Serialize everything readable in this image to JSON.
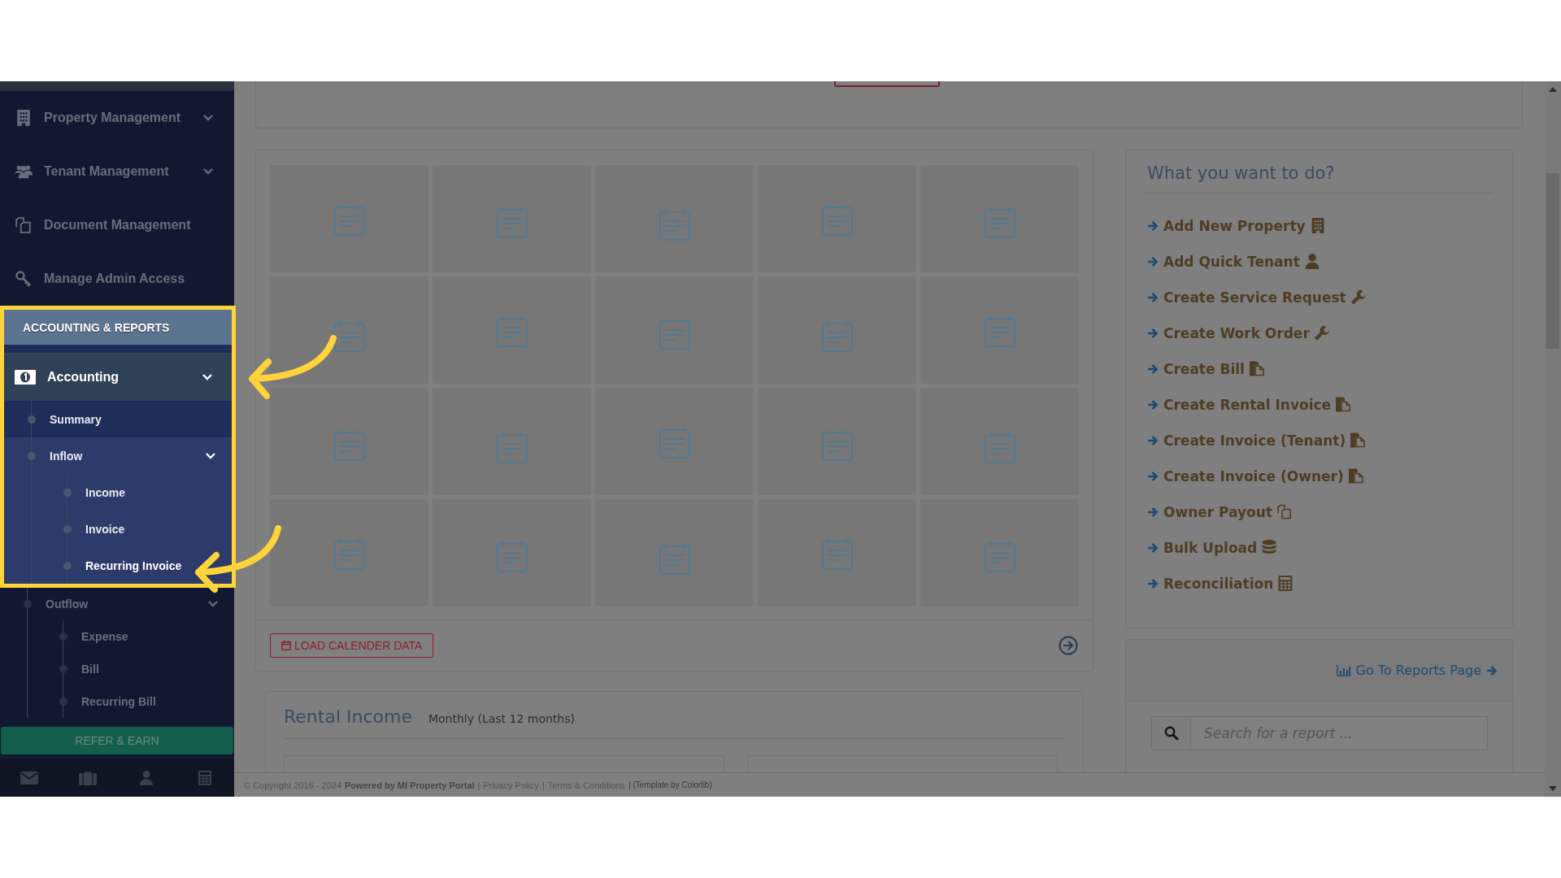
{
  "sidebar": {
    "menu": [
      {
        "label": "Property Management",
        "kind": "building",
        "has_submenu": true
      },
      {
        "label": "Tenant Management",
        "kind": "users",
        "has_submenu": true
      },
      {
        "label": "Document Management",
        "kind": "copy",
        "has_submenu": false
      },
      {
        "label": "Manage Admin Access",
        "kind": "key",
        "has_submenu": false
      }
    ],
    "section": {
      "title": "ACCOUNTING & REPORTS",
      "highlighted": true
    },
    "accounting": {
      "label": "Accounting",
      "kind": "money",
      "has_submenu": true,
      "highlighted": true,
      "children": [
        {
          "label": "Summary",
          "highlighted": true,
          "selected": false
        },
        {
          "label": "Inflow",
          "highlighted": true,
          "selected": false,
          "children": [
            {
              "label": "Income",
              "highlighted": true,
              "selected": false
            },
            {
              "label": "Invoice",
              "highlighted": true,
              "selected": false
            },
            {
              "label": "Recurring Invoice",
              "highlighted": true,
              "selected": true
            }
          ]
        },
        {
          "label": "Outflow",
          "highlighted": false,
          "selected": false,
          "children": [
            {
              "label": "Expense",
              "highlighted": false,
              "selected": false
            },
            {
              "label": "Bill",
              "highlighted": false,
              "selected": false
            },
            {
              "label": "Recurring Bill",
              "highlighted": false,
              "selected": false
            }
          ]
        }
      ]
    },
    "refer_button": "REFER & EARN"
  },
  "calendar": {
    "load_button": "LOAD CALENDER DATA"
  },
  "rental_income": {
    "title": "Rental Income",
    "subtitle": "Monthly (Last 12 months)"
  },
  "quick_actions": {
    "title": "What you want to do?",
    "items": [
      {
        "label": "Add New Property",
        "kind": "building"
      },
      {
        "label": "Add Quick Tenant",
        "kind": "user"
      },
      {
        "label": "Create Service Request",
        "kind": "wrench"
      },
      {
        "label": "Create Work Order",
        "kind": "wrench"
      },
      {
        "label": "Create Bill",
        "kind": "files"
      },
      {
        "label": "Create Rental Invoice",
        "kind": "files"
      },
      {
        "label": "Create Invoice (Tenant)",
        "kind": "files"
      },
      {
        "label": "Create Invoice (Owner)",
        "kind": "files"
      },
      {
        "label": "Owner Payout",
        "kind": "copy"
      },
      {
        "label": "Bulk Upload",
        "kind": "database"
      },
      {
        "label": "Reconciliation",
        "kind": "calculator"
      }
    ]
  },
  "reports": {
    "link": "Go To Reports Page",
    "search": {
      "placeholder": "Search for a report ..."
    }
  },
  "footer": [
    {
      "kind": "text",
      "text": "© Copyright 2016 - 2024"
    },
    {
      "kind": "strong",
      "text": "Powered by MI Property Portal"
    },
    {
      "kind": "sep",
      "text": "|"
    },
    {
      "kind": "link",
      "text": "Privacy Policy"
    },
    {
      "kind": "sep",
      "text": "|"
    },
    {
      "kind": "link",
      "text": "Terms & Conditions"
    },
    {
      "kind": "small",
      "text": "| (Template by Colorlib)"
    }
  ]
}
